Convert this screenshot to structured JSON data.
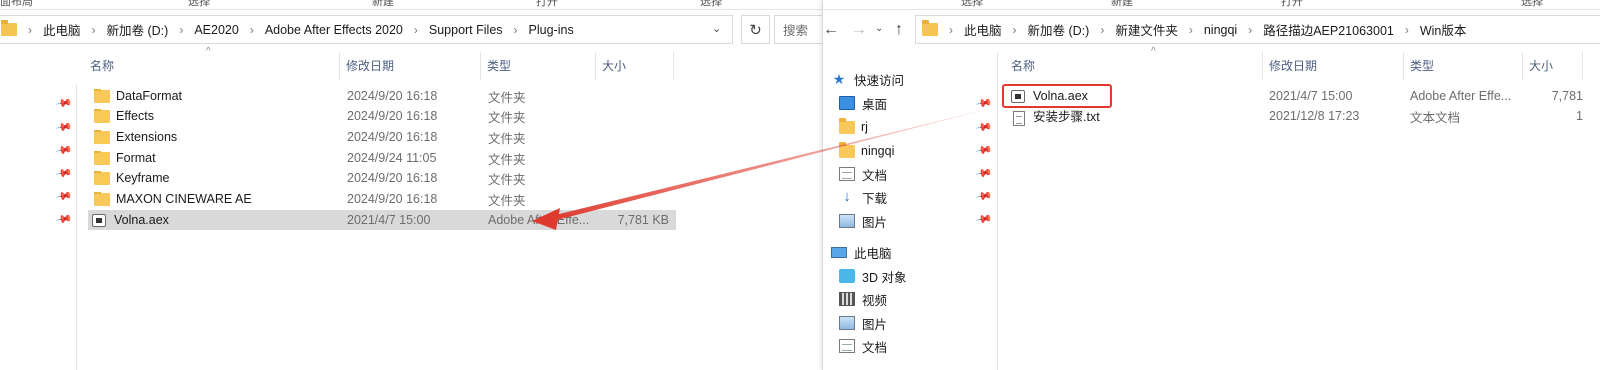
{
  "left": {
    "ribbon": [
      "面布局",
      "选择",
      "新建",
      "打开",
      "选择"
    ],
    "breadcrumb": [
      "此电脑",
      "新加卷 (D:)",
      "AE2020",
      "Adobe After Effects 2020",
      "Support Files",
      "Plug-ins"
    ],
    "columns": [
      "名称",
      "修改日期",
      "类型",
      "大小"
    ],
    "rows": [
      {
        "name": "DataFormat",
        "date": "2024/9/20 16:18",
        "type": "文件夹",
        "size": "",
        "icon": "folder"
      },
      {
        "name": "Effects",
        "date": "2024/9/20 16:18",
        "type": "文件夹",
        "size": "",
        "icon": "folder"
      },
      {
        "name": "Extensions",
        "date": "2024/9/20 16:18",
        "type": "文件夹",
        "size": "",
        "icon": "folder"
      },
      {
        "name": "Format",
        "date": "2024/9/24 11:05",
        "type": "文件夹",
        "size": "",
        "icon": "folder"
      },
      {
        "name": "Keyframe",
        "date": "2024/9/20 16:18",
        "type": "文件夹",
        "size": "",
        "icon": "folder"
      },
      {
        "name": "MAXON CINEWARE AE",
        "date": "2024/9/20 16:18",
        "type": "文件夹",
        "size": "",
        "icon": "folder"
      },
      {
        "name": "Volna.aex",
        "date": "2021/4/7 15:00",
        "type": "Adobe After Effe...",
        "size": "7,781 KB",
        "icon": "aex"
      }
    ]
  },
  "right": {
    "ribbon": [
      "选择",
      "新建",
      "打开",
      "选择"
    ],
    "search_placeholder": "搜索",
    "breadcrumb": [
      "此电脑",
      "新加卷 (D:)",
      "新建文件夹",
      "ningqi",
      "路径描边AEP21063001",
      "Win版本"
    ],
    "columns": [
      "名称",
      "修改日期",
      "类型",
      "大小"
    ],
    "rows": [
      {
        "name": "Volna.aex",
        "date": "2021/4/7 15:00",
        "type": "Adobe After Effe...",
        "size": "7,781",
        "icon": "aex"
      },
      {
        "name": "安装步骤.txt",
        "date": "2021/12/8 17:23",
        "type": "文本文档",
        "size": "1",
        "icon": "txt"
      }
    ],
    "nav_pane": [
      {
        "label": "快速访问",
        "icon": "star-icon"
      },
      {
        "label": "桌面",
        "icon": "desktop-icon"
      },
      {
        "label": "rj",
        "icon": "folder-icon"
      },
      {
        "label": "ningqi",
        "icon": "folder-icon"
      },
      {
        "label": "文档",
        "icon": "document-icon"
      },
      {
        "label": "下载",
        "icon": "download-icon"
      },
      {
        "label": "图片",
        "icon": "pictures-icon"
      },
      {
        "label": "此电脑",
        "icon": "computer-icon"
      },
      {
        "label": "3D 对象",
        "icon": "3d-objects-icon"
      },
      {
        "label": "视频",
        "icon": "video-icon"
      },
      {
        "label": "图片",
        "icon": "pictures-icon"
      },
      {
        "label": "文档",
        "icon": "document-icon"
      }
    ]
  },
  "colors": {
    "annotation": "#e03a2e",
    "selection": "#d9d9d9",
    "header_text": "#4d6082"
  }
}
